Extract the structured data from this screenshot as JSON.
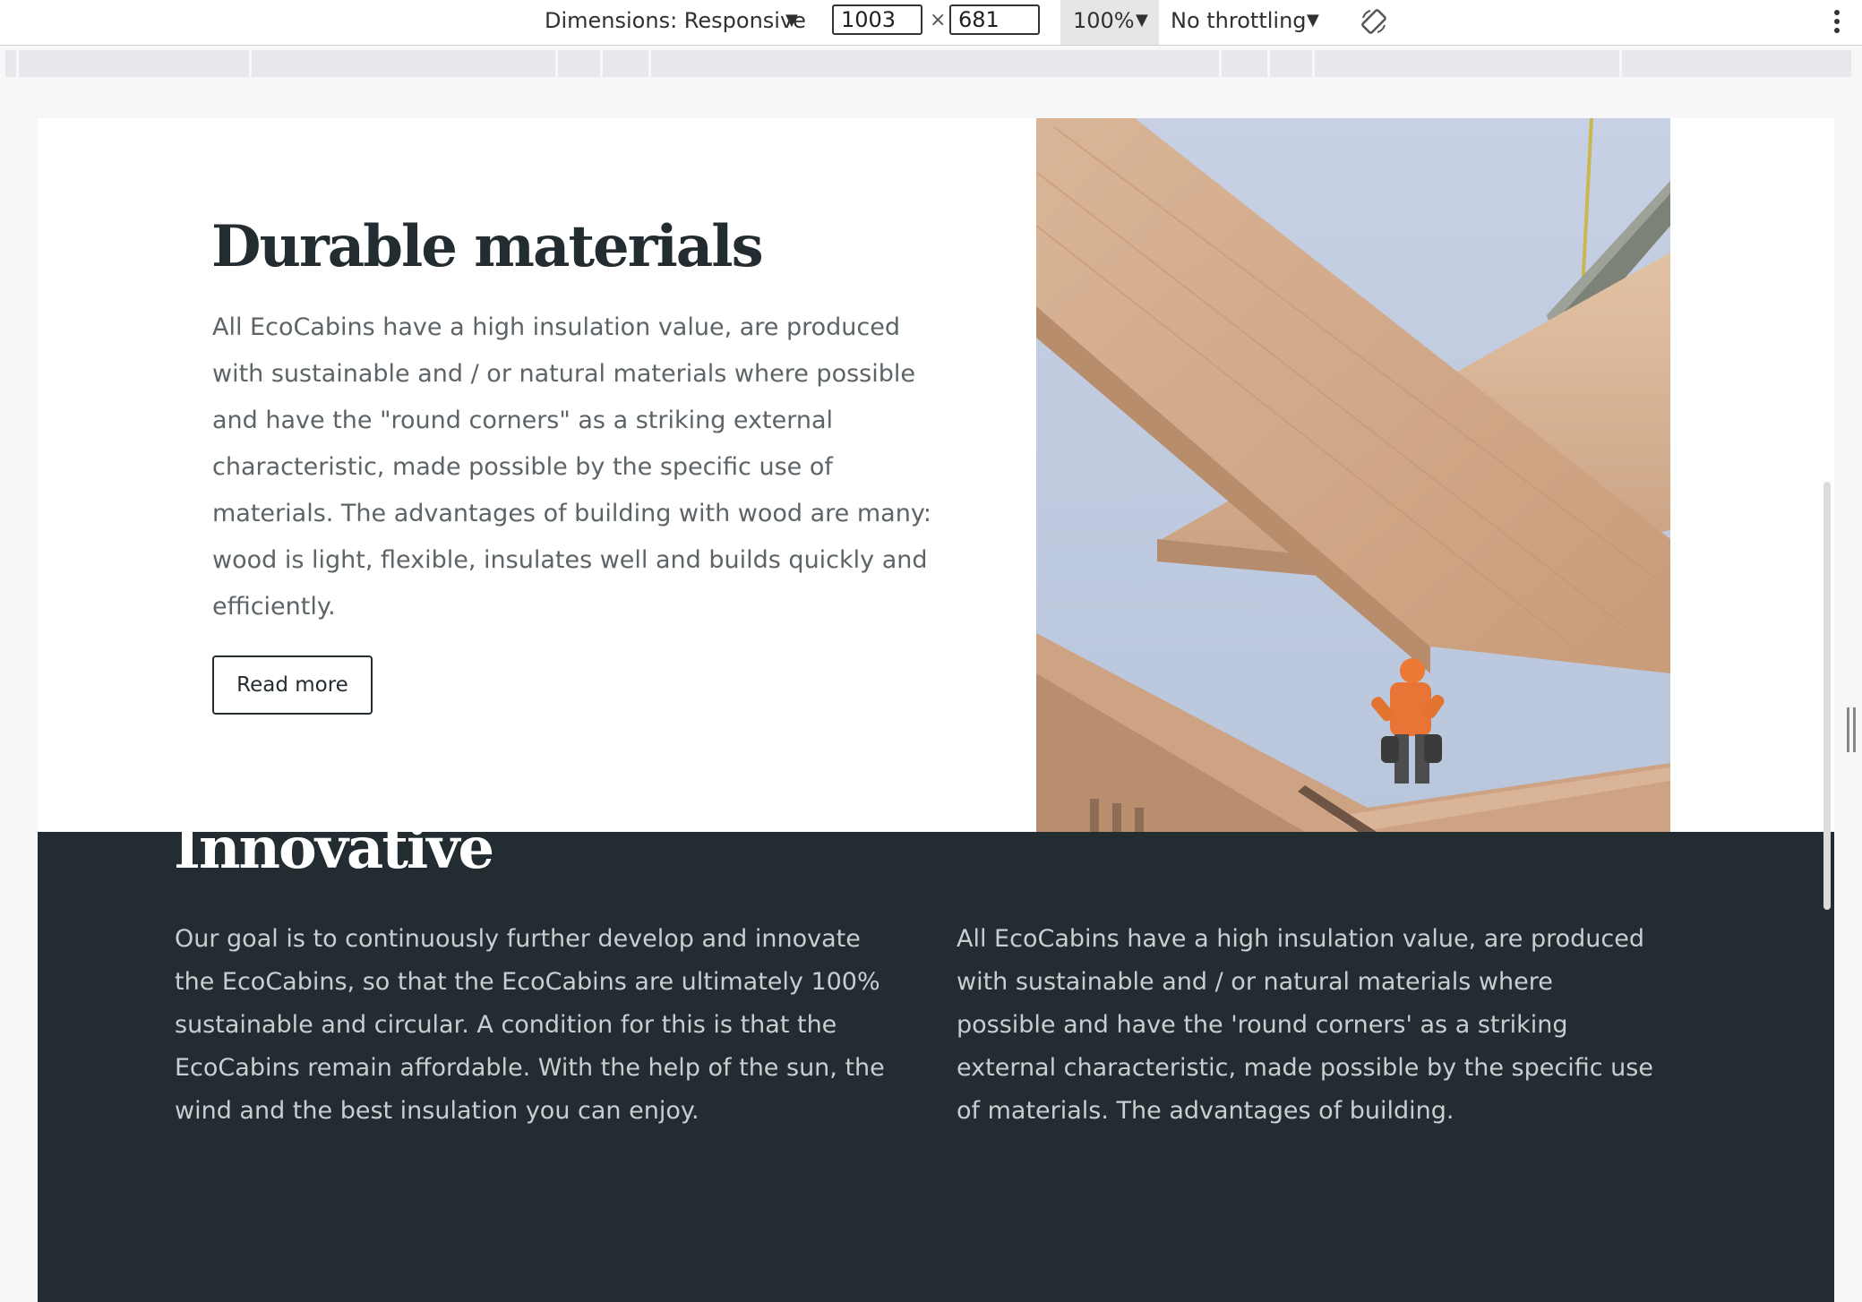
{
  "devtools": {
    "dimensions_label": "Dimensions: Responsive",
    "width_value": "1003",
    "times_sign": "×",
    "height_value": "681",
    "zoom_label": "100%",
    "throttling_label": "No throttling",
    "caret": "▼"
  },
  "durable": {
    "title": "Durable materials",
    "body": "All EcoCabins have a high insulation value, are produced with sustainable and / or natural materials where possible and have the \"round corners\" as a striking external characteristic, made possible by the specific use of materials. The advantages of building with wood are many: wood is light, flexible, insulates well and builds quickly and efficiently.",
    "button_label": "Read more"
  },
  "innovative": {
    "title": "Innovative",
    "left_text": "Our goal is to continuously further develop and innovate the EcoCabins, so that the EcoCabins are ultimately 100% sustainable and circular. A condition for this is that the EcoCabins remain affordable. With the help of the sun, the wind and the best insulation you can enjoy.",
    "right_text": "All EcoCabins have a high insulation value, are produced with sustainable and / or natural materials where possible and have the 'round corners' as a striking external characteristic, made possible by the specific use of materials. The advantages of building."
  },
  "colors": {
    "dark_section": "#222c31",
    "heading_dark": "#222c31",
    "body_text": "#5c6468",
    "light_text": "#c9ced1"
  }
}
